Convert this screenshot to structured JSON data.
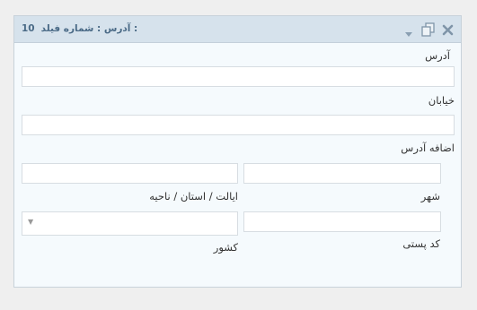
{
  "header": {
    "title": "آدرس : شماره فیلد :",
    "field_number": "10"
  },
  "icons": {
    "close": "close-icon",
    "duplicate": "duplicate-icon",
    "toggle": "chevron-down-icon"
  },
  "fields": {
    "address_label": "آدرس",
    "address_value": "",
    "street_label": "خیابان",
    "street_value": "",
    "address2_label": "اضافه آدرس",
    "address2_value": "",
    "city_label": "شهر",
    "city_value": "",
    "state_label": "ایالت / استان / ناحیه",
    "state_value": "",
    "postcode_label": "کد پستی",
    "postcode_value": "",
    "country_label": "کشور",
    "country_value": ""
  }
}
